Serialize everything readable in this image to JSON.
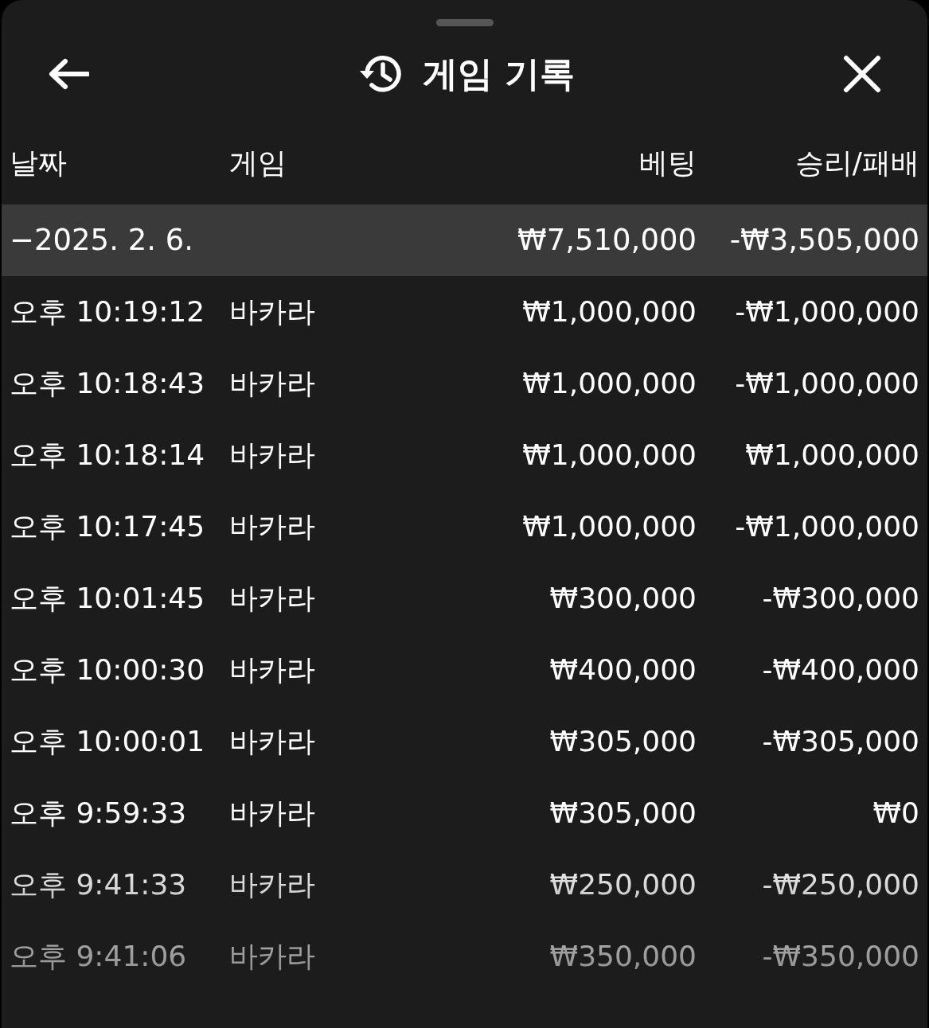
{
  "header": {
    "title": "게임 기록"
  },
  "columns": [
    "날짜",
    "게임",
    "베팅",
    "승리/패배"
  ],
  "group": {
    "date": "−2025. 2. 6.",
    "bet": "₩7,510,000",
    "result": "-₩3,505,000"
  },
  "rows": [
    {
      "time": "오후 10:19:12",
      "game": "바카라",
      "bet": "₩1,000,000",
      "result": "-₩1,000,000"
    },
    {
      "time": "오후 10:18:43",
      "game": "바카라",
      "bet": "₩1,000,000",
      "result": "-₩1,000,000"
    },
    {
      "time": "오후 10:18:14",
      "game": "바카라",
      "bet": "₩1,000,000",
      "result": "₩1,000,000"
    },
    {
      "time": "오후 10:17:45",
      "game": "바카라",
      "bet": "₩1,000,000",
      "result": "-₩1,000,000"
    },
    {
      "time": "오후 10:01:45",
      "game": "바카라",
      "bet": "₩300,000",
      "result": "-₩300,000"
    },
    {
      "time": "오후 10:00:30",
      "game": "바카라",
      "bet": "₩400,000",
      "result": "-₩400,000"
    },
    {
      "time": "오후 10:00:01",
      "game": "바카라",
      "bet": "₩305,000",
      "result": "-₩305,000"
    },
    {
      "time": "오후 9:59:33",
      "game": "바카라",
      "bet": "₩305,000",
      "result": "₩0"
    },
    {
      "time": "오후 9:41:33",
      "game": "바카라",
      "bet": "₩250,000",
      "result": "-₩250,000"
    },
    {
      "time": "오후 9:41:06",
      "game": "바카라",
      "bet": "₩350,000",
      "result": "-₩350,000"
    }
  ]
}
